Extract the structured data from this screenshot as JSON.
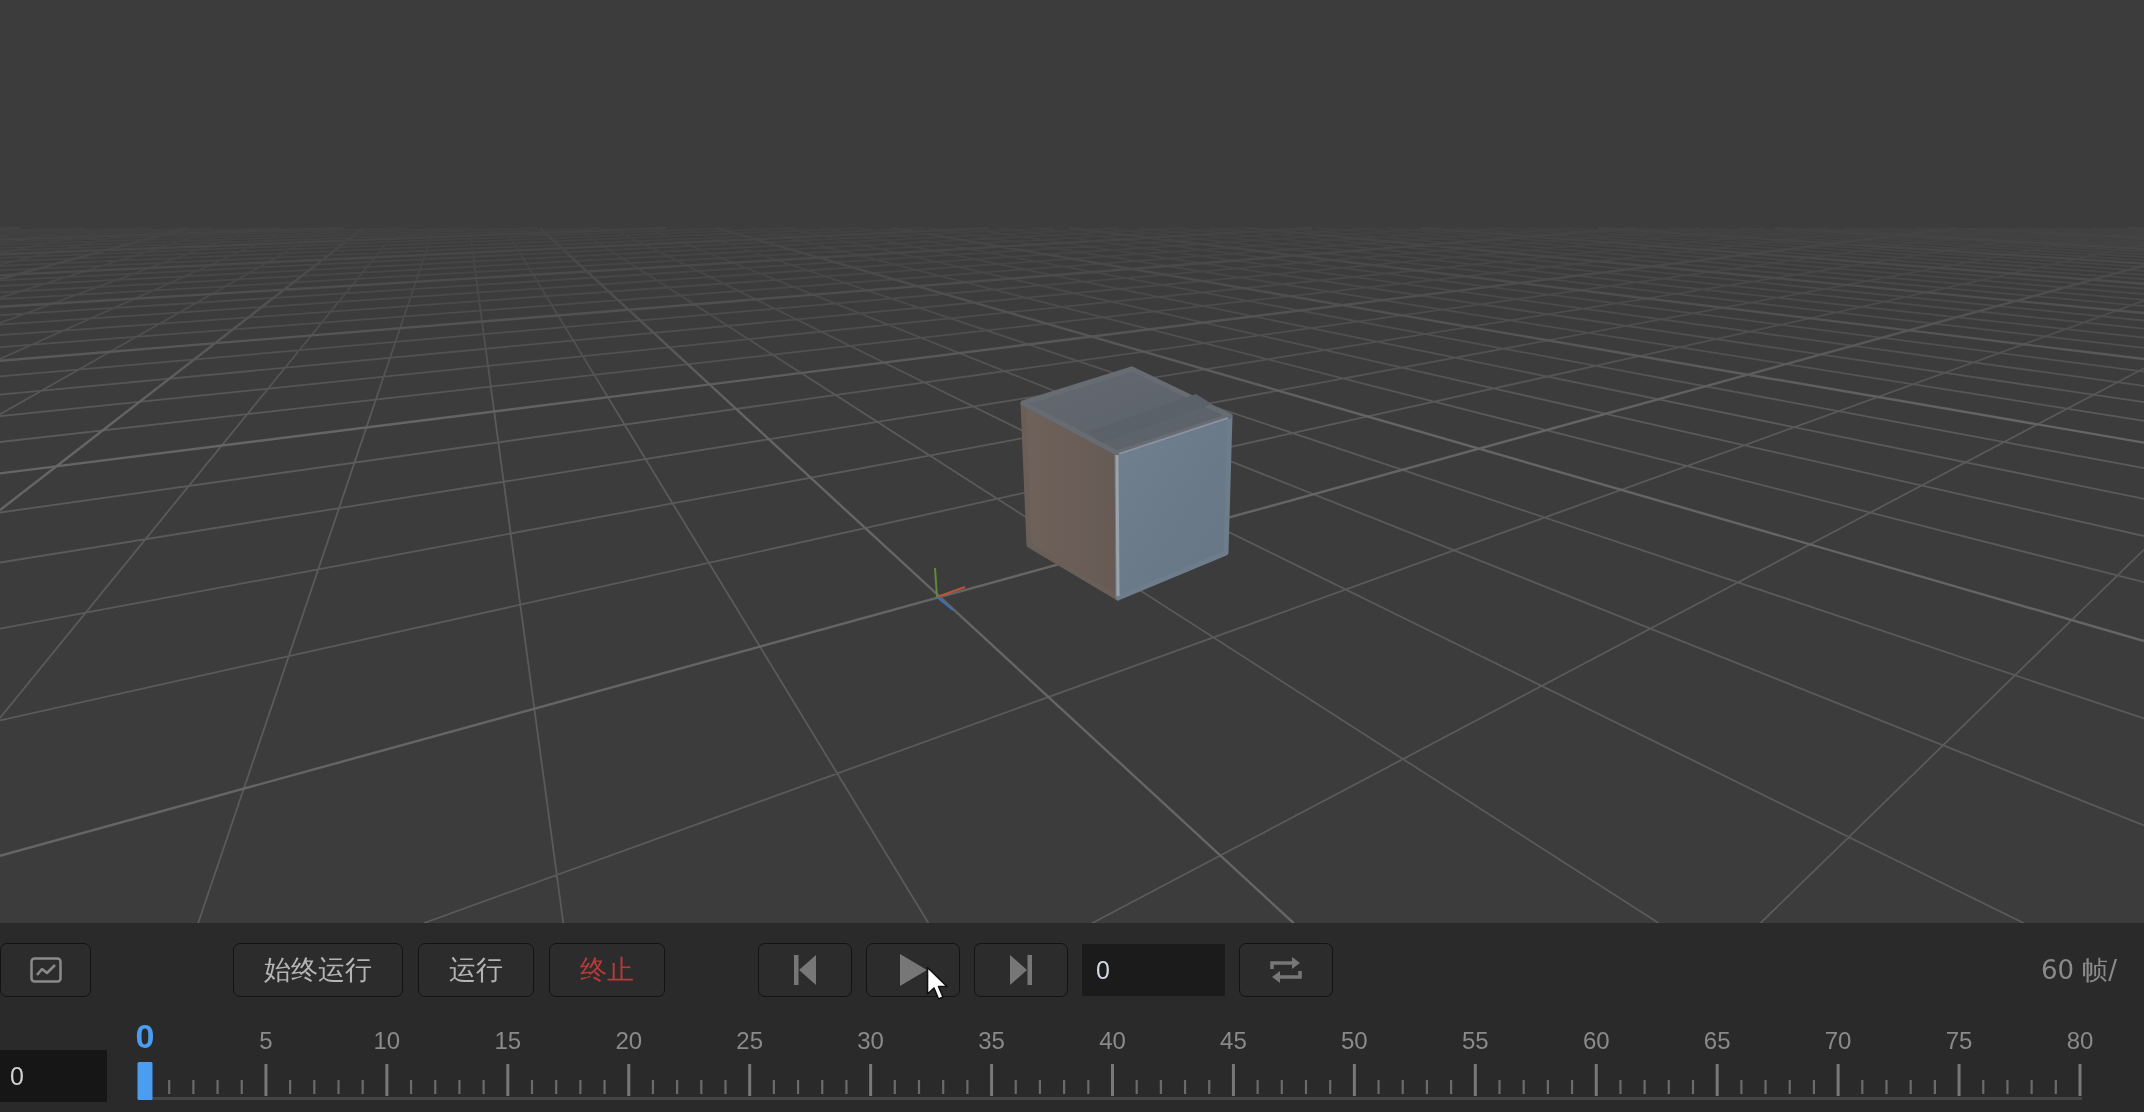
{
  "toolbar": {
    "run_buttons": [
      {
        "label": "始终运行",
        "kind": "normal"
      },
      {
        "label": "运行",
        "kind": "normal"
      },
      {
        "label": "终止",
        "kind": "danger"
      }
    ],
    "frame_field": {
      "value": "0"
    },
    "fps_label": "60 帧/"
  },
  "timeline": {
    "frame_field": {
      "value": "0"
    },
    "labels": [
      {
        "text": "0",
        "selected": true
      },
      {
        "text": "5",
        "selected": false
      },
      {
        "text": "10",
        "selected": false
      },
      {
        "text": "15",
        "selected": false
      },
      {
        "text": "20",
        "selected": false
      },
      {
        "text": "25",
        "selected": false
      },
      {
        "text": "30",
        "selected": false
      },
      {
        "text": "35",
        "selected": false
      },
      {
        "text": "40",
        "selected": false
      },
      {
        "text": "45",
        "selected": false
      },
      {
        "text": "50",
        "selected": false
      },
      {
        "text": "55",
        "selected": false
      },
      {
        "text": "60",
        "selected": false
      },
      {
        "text": "65",
        "selected": false
      },
      {
        "text": "70",
        "selected": false
      },
      {
        "text": "75",
        "selected": false
      },
      {
        "text": "80",
        "selected": false
      }
    ]
  }
}
